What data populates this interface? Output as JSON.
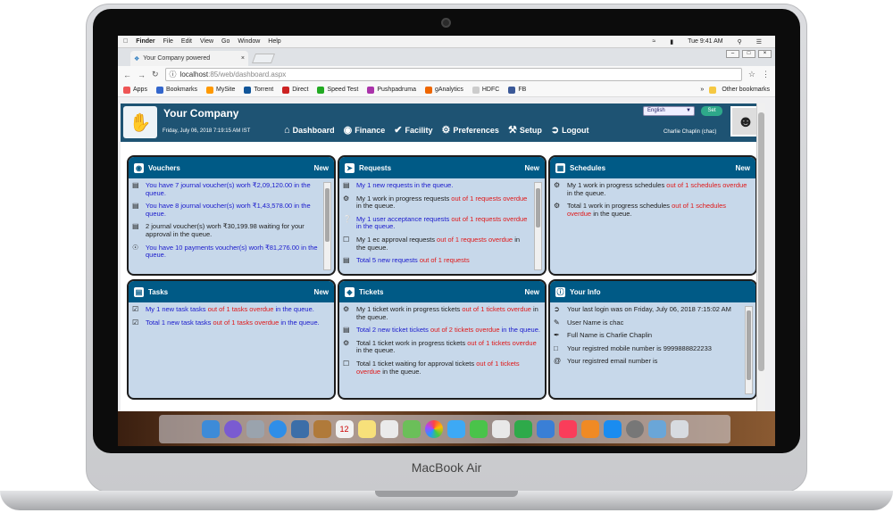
{
  "device": {
    "brand": "MacBook Air"
  },
  "menubar": {
    "apple": "",
    "items": [
      "Finder",
      "File",
      "Edit",
      "View",
      "Go",
      "Window",
      "Help"
    ],
    "clock": "Tue 9:41 AM"
  },
  "browser": {
    "tab_title": "Your Company powered",
    "url_host": "localhost",
    "url_rest": ":85/web/dashboard.aspx",
    "bookmarks": [
      "Apps",
      "Bookmarks",
      "MySite",
      "Torrent",
      "Direct",
      "Speed Test",
      "Pushpadruma",
      "gAnalytics",
      "HDFC",
      "FB"
    ],
    "other_bookmarks": "Other bookmarks"
  },
  "site": {
    "name": "Your Company",
    "date": "Friday, July 06, 2018 7:19:15 AM IST",
    "language": "English",
    "set_label": "Set",
    "user": "Charlie Chaplin (chac)",
    "nav": [
      "Dashboard",
      "Finance",
      "Facility",
      "Preferences",
      "Setup",
      "Logout"
    ]
  },
  "cards": {
    "vouchers": {
      "title": "Vouchers",
      "new": "New",
      "items": [
        {
          "t1": "You have 7 journal voucher(s) worh ₹2,09,120.00 in the queue."
        },
        {
          "t1": "You have 8 journal voucher(s) worh ₹1,43,578.00 in the queue."
        },
        {
          "t1": "2 journal voucher(s) worh ₹30,199.98 waiting for your approval in the queue."
        },
        {
          "t1": "You have 10 payments voucher(s) worh ₹81,276.00 in the queue."
        }
      ]
    },
    "requests": {
      "title": "Requests",
      "new": "New",
      "items": [
        {
          "a": "My 1 new requests in the queue.",
          "b": "",
          "c": ""
        },
        {
          "a": "My 1 work in progress requests ",
          "b": "out of 1 requests overdue",
          "c": " in the queue."
        },
        {
          "a": "My 1 user acceptance requests ",
          "b": "out of 1 requests overdue",
          "c": " in the queue."
        },
        {
          "a": "My 1 ec approval requests ",
          "b": "out of 1 requests overdue",
          "c": " in the queue."
        },
        {
          "a": "Total 5 new requests ",
          "b": "out of 1 requests",
          "c": ""
        }
      ]
    },
    "schedules": {
      "title": "Schedules",
      "new": "New",
      "items": [
        {
          "a": "My 1 work in progress schedules ",
          "b": "out of 1 schedules overdue",
          "c": " in the queue."
        },
        {
          "a": "Total 1 work in progress schedules ",
          "b": "out of 1 schedules overdue",
          "c": " in the queue."
        }
      ]
    },
    "tasks": {
      "title": "Tasks",
      "new": "New",
      "items": [
        {
          "a": "My 1 new task tasks ",
          "b": "out of 1 tasks overdue",
          "c": " in the queue."
        },
        {
          "a": "Total 1 new task tasks ",
          "b": "out of 1 tasks overdue",
          "c": " in the queue."
        }
      ]
    },
    "tickets": {
      "title": "Tickets",
      "new": "New",
      "items": [
        {
          "a": "My 1 ticket work in progress tickets ",
          "b": "out of 1 tickets overdue",
          "c": " in the queue."
        },
        {
          "a": "Total 2 new ticket tickets ",
          "b": "out of 2 tickets overdue",
          "c": " in the queue."
        },
        {
          "a": "Total 1 ticket work in progress tickets ",
          "b": "out of 1 tickets overdue",
          "c": " in the queue."
        },
        {
          "a": "Total 1 ticket waiting for approval tickets ",
          "b": "out of 1 tickets overdue",
          "c": " in the queue."
        }
      ]
    },
    "info": {
      "title": "Your Info",
      "items": [
        "Your last login was on Friday, July 06, 2018 7:15:02 AM",
        "User Name is chac",
        "Full Name is Charlie Chaplin",
        "Your registred mobile number is 9999888822233",
        "Your registred email number is"
      ]
    }
  }
}
